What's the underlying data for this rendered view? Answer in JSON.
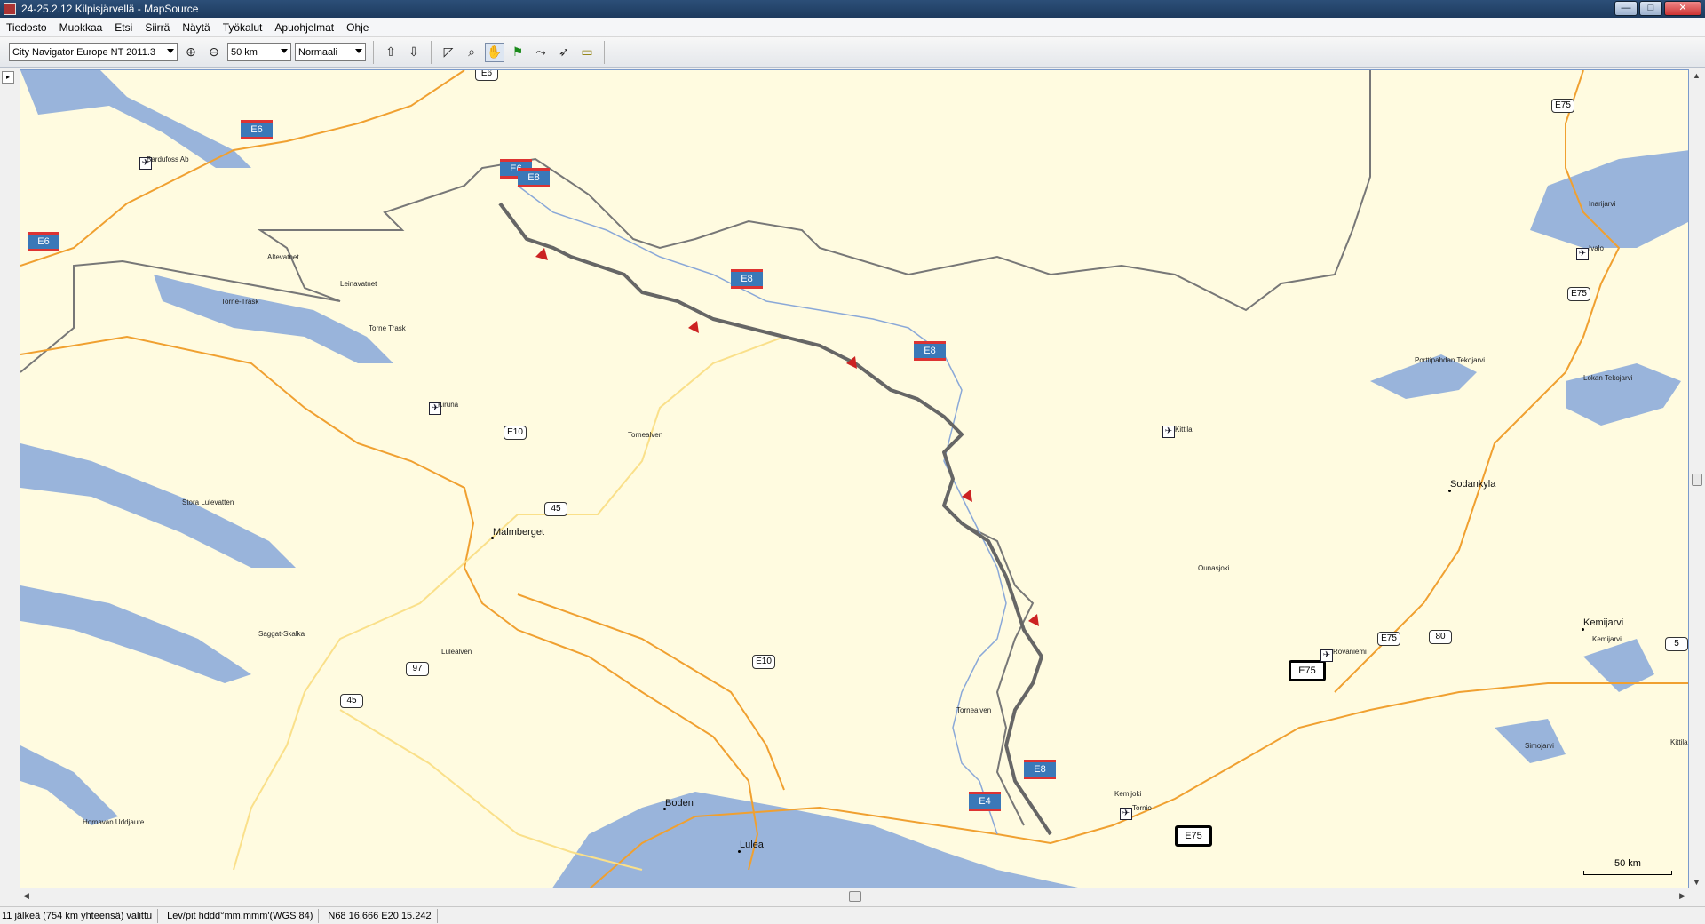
{
  "window": {
    "title": "24-25.2.12 Kilpisjärvellä - MapSource",
    "minimize": "—",
    "maximize": "□",
    "close": "✕"
  },
  "menu": [
    "Tiedosto",
    "Muokkaa",
    "Etsi",
    "Siirrä",
    "Näytä",
    "Työkalut",
    "Apuohjelmat",
    "Ohje"
  ],
  "toolbar": {
    "map_product": "City Navigator Europe NT 2011.3",
    "zoom_scale": "50 km",
    "detail": "Normaali",
    "icons": [
      "zoom-in-icon",
      "zoom-out-icon",
      "receive-from-device-icon",
      "send-to-device-icon",
      "map-tool-icon",
      "zoom-tool-icon",
      "hand-tool-icon",
      "waypoint-tool-icon",
      "route-tool-icon",
      "selection-tool-icon",
      "measure-tool-icon"
    ]
  },
  "map": {
    "cities": [
      {
        "name": "Malmberget"
      },
      {
        "name": "Boden"
      },
      {
        "name": "Lulea"
      },
      {
        "name": "Sodankyla"
      },
      {
        "name": "Kemijarvi"
      }
    ],
    "places": [
      "Bardufoss Ab",
      "Altevatnet",
      "Leinavatnet",
      "Torne-Trask",
      "Torne Trask",
      "Kiruna",
      "Tornealven",
      "Stora Lulevatten",
      "Saggat-Skalka",
      "Lulealven",
      "Hornavan Uddjaure",
      "Tornealven",
      "Kemijoki",
      "Tornio",
      "Ivalo",
      "Inarijarvi",
      "Porttipahdan Tekojarvi",
      "Lokan Tekojarvi",
      "Kittila",
      "Ounasjoki",
      "Rovaniemi",
      "Kemijarvi",
      "Simojarvi",
      "Kittila"
    ],
    "shields": {
      "european": [
        "E6",
        "E6",
        "E6",
        "E8",
        "E8",
        "E8",
        "E8",
        "E4"
      ],
      "white": [
        "E6",
        "E10",
        "45",
        "97",
        "45",
        "E10",
        "E75",
        "E75",
        "E75",
        "80",
        "5"
      ],
      "bold": [
        "E75",
        "E75"
      ]
    },
    "scale_label": "50 km"
  },
  "status": {
    "selection": "11 jälkeä (754 km yhteensä) valittu",
    "format": "Lev/pit hddd°mm.mmm'(WGS 84)",
    "coords": "N68 16.666 E20 15.242"
  }
}
